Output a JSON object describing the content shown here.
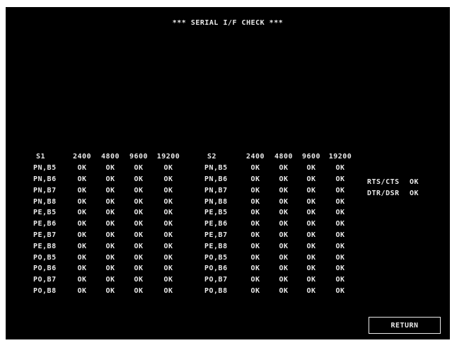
{
  "title": "*** SERIAL I/F CHECK ***",
  "baud_rates": [
    "2400",
    "4800",
    "9600",
    "19200"
  ],
  "ports": [
    {
      "label": "S1",
      "rows": [
        {
          "mode": "PN,B5",
          "results": [
            "OK",
            "OK",
            "OK",
            "OK"
          ]
        },
        {
          "mode": "PN,B6",
          "results": [
            "OK",
            "OK",
            "OK",
            "OK"
          ]
        },
        {
          "mode": "PN,B7",
          "results": [
            "OK",
            "OK",
            "OK",
            "OK"
          ]
        },
        {
          "mode": "PN,B8",
          "results": [
            "OK",
            "OK",
            "OK",
            "OK"
          ]
        },
        {
          "mode": "PE,B5",
          "results": [
            "OK",
            "OK",
            "OK",
            "OK"
          ]
        },
        {
          "mode": "PE,B6",
          "results": [
            "OK",
            "OK",
            "OK",
            "OK"
          ]
        },
        {
          "mode": "PE,B7",
          "results": [
            "OK",
            "OK",
            "OK",
            "OK"
          ]
        },
        {
          "mode": "PE,B8",
          "results": [
            "OK",
            "OK",
            "OK",
            "OK"
          ]
        },
        {
          "mode": "PO,B5",
          "results": [
            "OK",
            "OK",
            "OK",
            "OK"
          ]
        },
        {
          "mode": "PO,B6",
          "results": [
            "OK",
            "OK",
            "OK",
            "OK"
          ]
        },
        {
          "mode": "PO,B7",
          "results": [
            "OK",
            "OK",
            "OK",
            "OK"
          ]
        },
        {
          "mode": "PO,B8",
          "results": [
            "OK",
            "OK",
            "OK",
            "OK"
          ]
        }
      ]
    },
    {
      "label": "S2",
      "rows": [
        {
          "mode": "PN,B5",
          "results": [
            "OK",
            "OK",
            "OK",
            "OK"
          ]
        },
        {
          "mode": "PN,B6",
          "results": [
            "OK",
            "OK",
            "OK",
            "OK"
          ]
        },
        {
          "mode": "PN,B7",
          "results": [
            "OK",
            "OK",
            "OK",
            "OK"
          ]
        },
        {
          "mode": "PN,B8",
          "results": [
            "OK",
            "OK",
            "OK",
            "OK"
          ]
        },
        {
          "mode": "PE,B5",
          "results": [
            "OK",
            "OK",
            "OK",
            "OK"
          ]
        },
        {
          "mode": "PE,B6",
          "results": [
            "OK",
            "OK",
            "OK",
            "OK"
          ]
        },
        {
          "mode": "PE,B7",
          "results": [
            "OK",
            "OK",
            "OK",
            "OK"
          ]
        },
        {
          "mode": "PE,B8",
          "results": [
            "OK",
            "OK",
            "OK",
            "OK"
          ]
        },
        {
          "mode": "PO,B5",
          "results": [
            "OK",
            "OK",
            "OK",
            "OK"
          ]
        },
        {
          "mode": "PO,B6",
          "results": [
            "OK",
            "OK",
            "OK",
            "OK"
          ]
        },
        {
          "mode": "PO,B7",
          "results": [
            "OK",
            "OK",
            "OK",
            "OK"
          ]
        },
        {
          "mode": "PO,B8",
          "results": [
            "OK",
            "OK",
            "OK",
            "OK"
          ]
        }
      ]
    }
  ],
  "handshake": [
    {
      "label": "RTS/CTS",
      "result": "OK"
    },
    {
      "label": "DTR/DSR",
      "result": "OK"
    }
  ],
  "return_button": "RETURN",
  "colors": {
    "background": "#000000",
    "text": "#e9e9e9"
  }
}
